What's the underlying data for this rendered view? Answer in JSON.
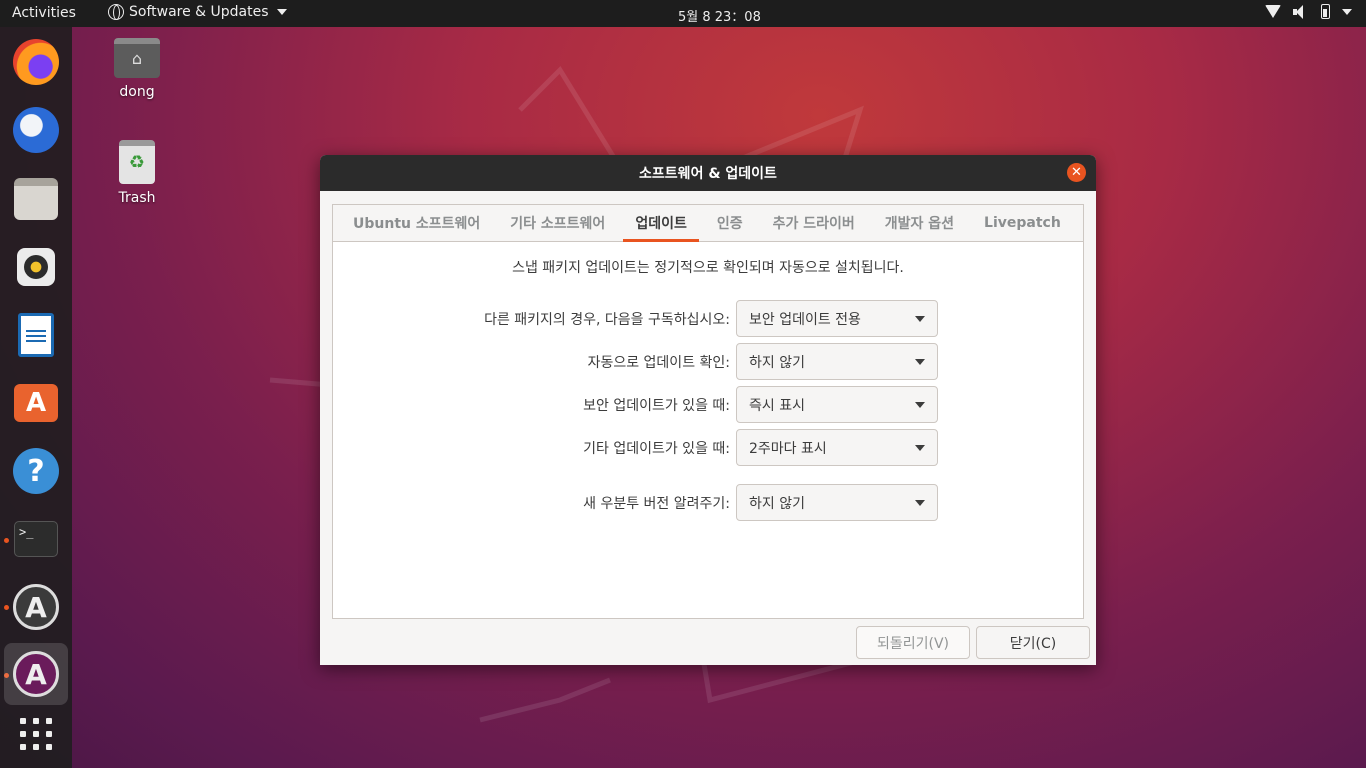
{
  "topbar": {
    "activities": "Activities",
    "app_menu": "Software & Updates",
    "clock": "5월 8  23：08"
  },
  "desktop": {
    "home_label": "dong",
    "trash_label": "Trash"
  },
  "dock": {
    "items": [
      "firefox-icon",
      "thunderbird-icon",
      "files-icon",
      "rhythmbox-icon",
      "writer-icon",
      "software-icon",
      "help-icon",
      "terminal-icon",
      "software-updater-icon",
      "software-properties-icon",
      "show-apps-icon"
    ],
    "terminal_prompt": ">_"
  },
  "dialog": {
    "title": "소프트웨어 & 업데이트",
    "close_symbol": "✕",
    "tabs": [
      {
        "label": "Ubuntu 소프트웨어"
      },
      {
        "label": "기타 소프트웨어"
      },
      {
        "label": "업데이트"
      },
      {
        "label": "인증"
      },
      {
        "label": "추가 드라이버"
      },
      {
        "label": "개발자 옵션"
      },
      {
        "label": "Livepatch"
      }
    ],
    "selected_tab": "업데이트",
    "info": "스냅 패키지 업데이트는 정기적으로 확인되며 자동으로 설치됩니다.",
    "rows": [
      {
        "label": "다른 패키지의 경우, 다음을 구독하십시오:",
        "value": "보안 업데이트 전용"
      },
      {
        "label": "자동으로 업데이트 확인:",
        "value": "하지 않기"
      },
      {
        "label": "보안 업데이트가 있을 때:",
        "value": "즉시 표시"
      },
      {
        "label": "기타 업데이트가 있을 때:",
        "value": "2주마다 표시"
      },
      {
        "label": "새 우분투 버전 알려주기:",
        "value": "하지 않기"
      }
    ],
    "revert_button": "되돌리기(V)",
    "close_button": "닫기(C)"
  },
  "colors": {
    "accent": "#e95420",
    "topbar": "#1d1d1d",
    "titlebar": "#2b2b2b"
  }
}
